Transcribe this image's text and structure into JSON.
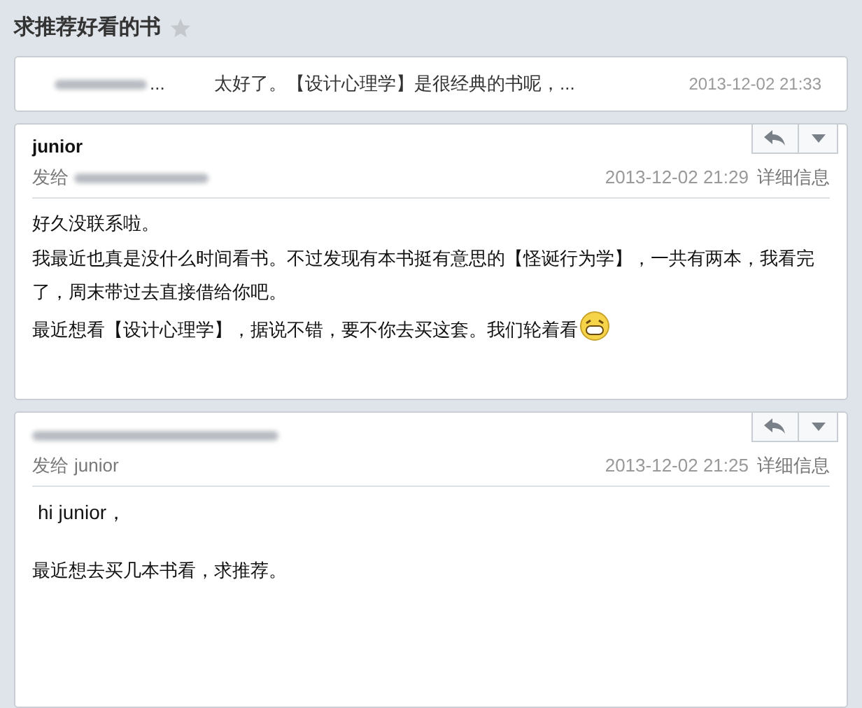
{
  "thread": {
    "subject": "求推荐好看的书",
    "starred": false
  },
  "collapsed_message": {
    "sender_suffix": "...",
    "snippet": "太好了。【设计心理学】是很经典的书呢，...",
    "date": "2013-12-02  21:33"
  },
  "messages": [
    {
      "sender": "junior",
      "sender_redacted": false,
      "to_label": "发给",
      "recipient_redacted": true,
      "date": "2013-12-02 21:29",
      "details_link": "详细信息",
      "paragraphs": [
        {
          "kind": "line",
          "text": "好久没联系啦。",
          "emoji": false
        },
        {
          "kind": "line",
          "text": "我最近也真是没什么时间看书。不过发现有本书挺有意思的【怪诞行为学】，一共有两本，我看完了，周末带过去直接借给你吧。",
          "emoji": false
        },
        {
          "kind": "line",
          "text": "最近想看【设计心理学】，据说不错，要不你去买这套。我们轮着看",
          "emoji": true
        }
      ]
    },
    {
      "sender_redacted": true,
      "to_label": "发给",
      "recipient": "junior",
      "recipient_redacted": false,
      "date": "2013-12-02 21:25",
      "details_link": "详细信息",
      "paragraphs": [
        {
          "kind": "greeting",
          "text": "hi junior，",
          "emoji": false
        },
        {
          "kind": "line",
          "text": "最近想去买几本书看，求推荐。",
          "emoji": false
        }
      ]
    }
  ]
}
